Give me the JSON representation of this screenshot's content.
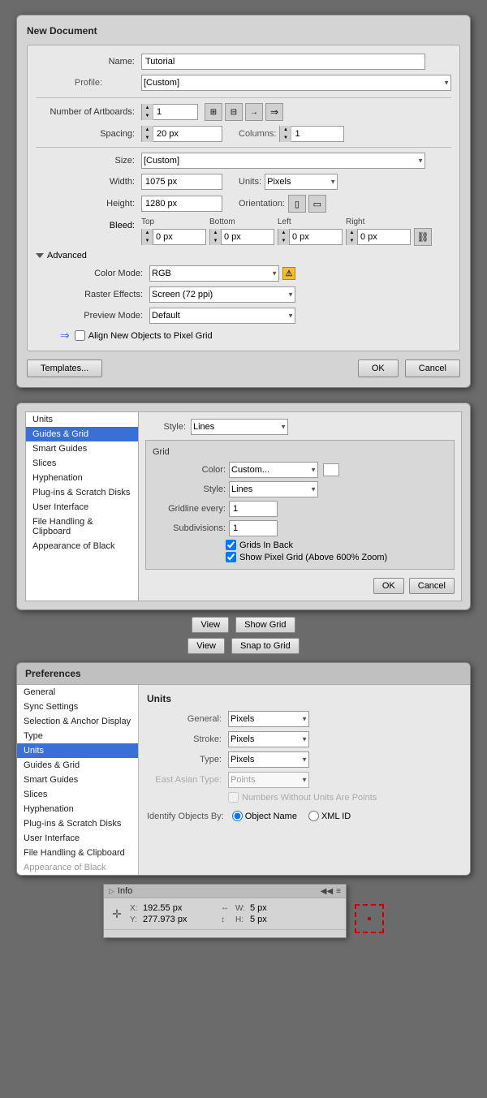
{
  "newDocument": {
    "title": "New Document",
    "nameLabel": "Name:",
    "nameValue": "Tutorial",
    "profileLabel": "Profile:",
    "profileValue": "[Custom]",
    "artboardsLabel": "Number of Artboards:",
    "artboardsValue": "1",
    "spacingLabel": "Spacing:",
    "spacingValue": "20 px",
    "columnsLabel": "Columns:",
    "columnsValue": "1",
    "sizeLabel": "Size:",
    "sizeValue": "[Custom]",
    "widthLabel": "Width:",
    "widthValue": "1075 px",
    "unitsLabel": "Units:",
    "unitsValue": "Pixels",
    "heightLabel": "Height:",
    "heightValue": "1280 px",
    "orientationLabel": "Orientation:",
    "bleedLabel": "Bleed:",
    "bleedTop": "0 px",
    "bleedBottom": "0 px",
    "bleedLeft": "0 px",
    "bleedRight": "0 px",
    "topLabel": "Top",
    "bottomLabel": "Bottom",
    "leftLabel": "Left",
    "rightLabel": "Right",
    "advancedLabel": "Advanced",
    "colorModeLabel": "Color Mode:",
    "colorModeValue": "RGB",
    "rasterLabel": "Raster Effects:",
    "rasterValue": "Screen (72 ppi)",
    "previewLabel": "Preview Mode:",
    "previewValue": "Default",
    "pixelGridLabel": "Align New Objects to Pixel Grid",
    "templatesBtn": "Templates...",
    "okBtn": "OK",
    "cancelBtn": "Cancel"
  },
  "prefsPanel": {
    "sidebarItems": [
      {
        "label": "Units",
        "active": false
      },
      {
        "label": "Guides & Grid",
        "active": true
      },
      {
        "label": "Smart Guides",
        "active": false
      },
      {
        "label": "Slices",
        "active": false
      },
      {
        "label": "Hyphenation",
        "active": false
      },
      {
        "label": "Plug-ins & Scratch Disks",
        "active": false
      },
      {
        "label": "User Interface",
        "active": false
      },
      {
        "label": "File Handling & Clipboard",
        "active": false
      },
      {
        "label": "Appearance of Black",
        "active": false
      }
    ],
    "guidesStyleLabel": "Style:",
    "guidesStyleValue": "Lines",
    "gridTitle": "Grid",
    "gridColorLabel": "Color:",
    "gridColorValue": "Custom...",
    "gridStyleLabel": "Style:",
    "gridStyleValue": "Lines",
    "gridlineEveryLabel": "Gridline every:",
    "gridlineEveryValue": "1",
    "subdivisionsLabel": "Subdivisions:",
    "subdivisionsValue": "1",
    "gridsInBackLabel": "Grids In Back",
    "gridsInBackChecked": true,
    "showPixelGridLabel": "Show Pixel Grid (Above 600% Zoom)",
    "showPixelGridChecked": true,
    "okBtn": "OK",
    "cancelBtn": "Cancel"
  },
  "viewButtons": {
    "viewLabel1": "View",
    "showGridLabel": "Show Grid",
    "viewLabel2": "View",
    "snapToGridLabel": "Snap to Grid"
  },
  "prefsDialog": {
    "title": "Preferences",
    "sidebarItems": [
      {
        "label": "General",
        "active": false
      },
      {
        "label": "Sync Settings",
        "active": false
      },
      {
        "label": "Selection & Anchor Display",
        "active": false
      },
      {
        "label": "Type",
        "active": false
      },
      {
        "label": "Units",
        "active": true
      },
      {
        "label": "Guides & Grid",
        "active": false
      },
      {
        "label": "Smart Guides",
        "active": false
      },
      {
        "label": "Slices",
        "active": false
      },
      {
        "label": "Hyphenation",
        "active": false
      },
      {
        "label": "Plug-ins & Scratch Disks",
        "active": false
      },
      {
        "label": "User Interface",
        "active": false
      },
      {
        "label": "File Handling & Clipboard",
        "active": false
      },
      {
        "label": "Appearance of Black",
        "active": false,
        "disabled": true
      }
    ],
    "mainTitle": "Units",
    "generalLabel": "General:",
    "generalValue": "Pixels",
    "strokeLabel": "Stroke:",
    "strokeValue": "Pixels",
    "typeLabel": "Type:",
    "typeValue": "Pixels",
    "eastAsianLabel": "East Asian Type:",
    "eastAsianValue": "Points",
    "noUnitsLabel": "Numbers Without Units Are Points",
    "identifyLabel": "Identify Objects By:",
    "objectNameLabel": "Object Name",
    "xmlIdLabel": "XML ID"
  },
  "infoPanel": {
    "title": "Info",
    "collapseBtn": "◀◀",
    "menuBtn": "≡",
    "xLabel": "X:",
    "xValue": "192.55 px",
    "yLabel": "Y:",
    "yValue": "277.973 px",
    "wLabel": "W:",
    "wValue": "5 px",
    "hLabel": "H:",
    "hValue": "5 px"
  }
}
